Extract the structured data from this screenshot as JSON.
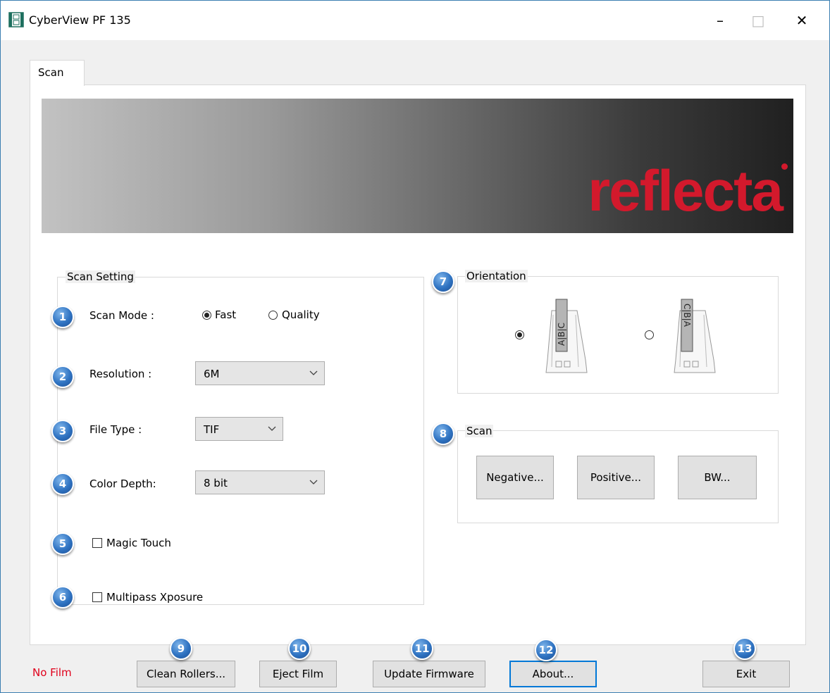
{
  "window": {
    "title": "CyberView PF 135",
    "controls": {
      "minimize": "–",
      "maximize": "□",
      "close": "✕"
    }
  },
  "tabs": [
    {
      "label": "Scan",
      "active": true
    }
  ],
  "banner": {
    "logo_text": "reflecta",
    "logo_color": "#d3192c"
  },
  "scan_setting": {
    "group_label": "Scan Setting",
    "scan_mode": {
      "label": "Scan Mode :",
      "options": [
        "Fast",
        "Quality"
      ],
      "selected": "Fast"
    },
    "resolution": {
      "label": "Resolution :",
      "value": "6M"
    },
    "file_type": {
      "label": "File Type :",
      "value": "TIF"
    },
    "color_depth": {
      "label": "Color Depth:",
      "value": "8 bit"
    },
    "magic_touch": {
      "label": "Magic Touch",
      "checked": false
    },
    "multipass": {
      "label": "Multipass Xposure",
      "checked": false
    }
  },
  "orientation": {
    "group_label": "Orientation",
    "selected_index": 0,
    "film_letters": [
      "A",
      "B",
      "C"
    ]
  },
  "scan_group": {
    "group_label": "Scan",
    "buttons": [
      "Negative...",
      "Positive...",
      "BW..."
    ]
  },
  "badges": [
    "1",
    "2",
    "3",
    "4",
    "5",
    "6",
    "7",
    "8",
    "9",
    "10",
    "11",
    "12",
    "13"
  ],
  "badge_color": "#2f73c2",
  "footer": {
    "status": "No Film",
    "status_color": "#e0001b",
    "buttons": {
      "clean": "Clean Rollers...",
      "eject": "Eject Film",
      "update": "Update Firmware",
      "about": "About...",
      "exit": "Exit"
    }
  }
}
